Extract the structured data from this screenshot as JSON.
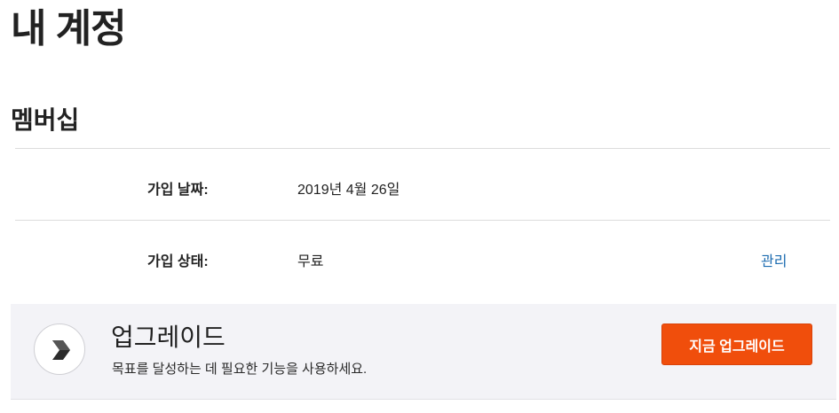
{
  "page": {
    "title": "내 계정"
  },
  "membership": {
    "section_title": "멤버십",
    "rows": [
      {
        "label": "가입 날짜:",
        "value": "2019년 4월 26일"
      },
      {
        "label": "가입 상태:",
        "value": "무료",
        "action": "관리"
      }
    ]
  },
  "upgrade": {
    "icon": "chevron-right-icon",
    "title": "업그레이드",
    "description": "목표를 달성하는 데 필요한 기능을 사용하세요.",
    "button_label": "지금 업그레이드",
    "button_color": "#f04e0c"
  },
  "colors": {
    "link": "#1b6bb0",
    "panel_bg": "#f3f3f7"
  }
}
